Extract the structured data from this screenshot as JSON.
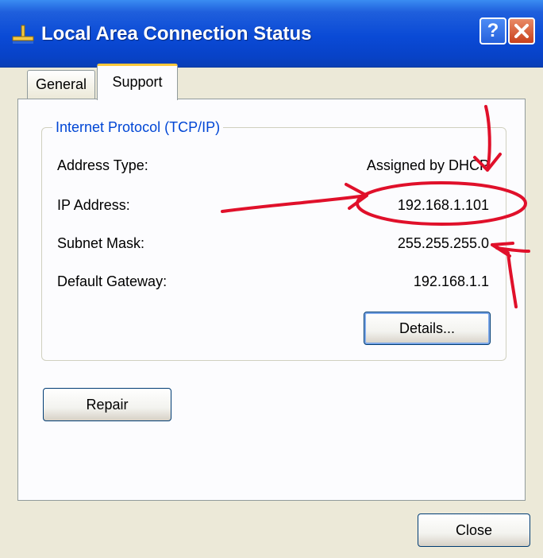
{
  "window": {
    "title": "Local Area Connection Status"
  },
  "tabs": [
    {
      "label": "General",
      "selected": false
    },
    {
      "label": "Support",
      "selected": true
    }
  ],
  "group": {
    "label": "Internet Protocol (TCP/IP)",
    "rows": [
      {
        "label": "Address Type:",
        "value": "Assigned by DHCP"
      },
      {
        "label": "IP Address:",
        "value": "192.168.1.101"
      },
      {
        "label": "Subnet Mask:",
        "value": "255.255.255.0"
      },
      {
        "label": "Default Gateway:",
        "value": "192.168.1.1"
      }
    ],
    "details_label": "Details..."
  },
  "repair_label": "Repair",
  "close_label": "Close",
  "icons": {
    "title": "network-connection-icon",
    "help": "help-icon",
    "close": "close-icon"
  },
  "colors": {
    "titlebar": "#0a4ad6",
    "group_label": "#0046d5",
    "annotation": "#e0102a",
    "tab_highlight": "#ffc83c"
  }
}
